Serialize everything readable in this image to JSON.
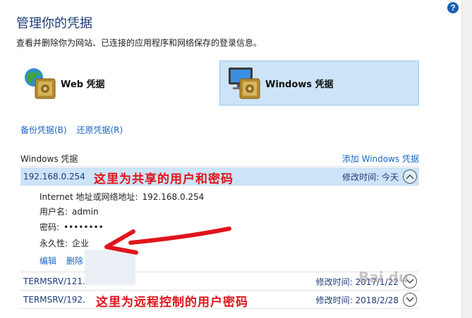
{
  "help": {
    "label": "?"
  },
  "title": "管理你的凭据",
  "subtitle": "查看并删除你为网站、已连接的应用程序和网络保存的登录信息。",
  "cred_types": {
    "web": {
      "label": "Web 凭据"
    },
    "windows": {
      "label": "Windows 凭据"
    }
  },
  "links": {
    "backup": "备份凭据(B)",
    "restore": "还原凭据(R)"
  },
  "section": {
    "label": "Windows 凭据",
    "add": "添加 Windows 凭据"
  },
  "items": [
    {
      "address": "192.168.0.254",
      "modified_label": "修改时间:",
      "modified": "今天",
      "expanded": true
    },
    {
      "address": "TERMSRV/121.",
      "modified_label": "修改时间:",
      "modified": "2017/1/22",
      "expanded": false
    },
    {
      "address": "TERMSRV/192.",
      "modified_label": "修改时间:",
      "modified": "2018/2/28",
      "expanded": false
    }
  ],
  "detail": {
    "internet_label": "Internet 地址或网络地址:",
    "internet_value": "192.168.0.254",
    "user_label": "用户名:",
    "user_value": "admin",
    "password_label": "密码:",
    "password_value": "••••••••",
    "persistence_label": "永久性:",
    "persistence_value": "企业",
    "edit": "编辑",
    "delete": "删除"
  },
  "annotations": {
    "shared": "这里为共享的用户和密码",
    "remote": "这里为远程控制的用户密码"
  },
  "watermark": "Bai du",
  "colors": {
    "accent": "#1a66c4",
    "selected_bg": "#cce4f7",
    "annotation": "#e0141b"
  }
}
